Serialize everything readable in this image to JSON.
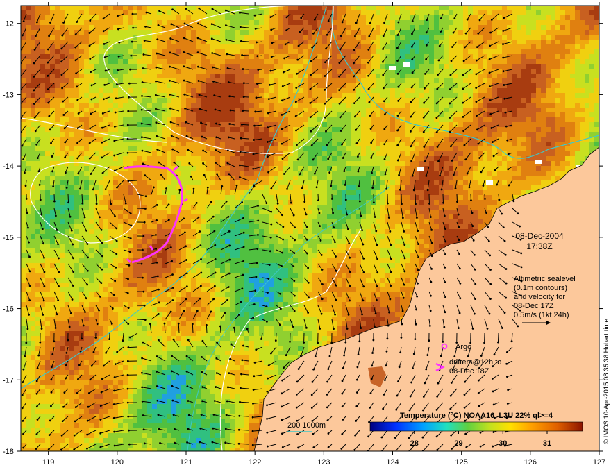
{
  "map": {
    "lon_range": [
      118.6,
      127.0
    ],
    "lat_range": [
      -18.0,
      -11.75
    ],
    "x_ticks": [
      {
        "value": 119,
        "label": "119"
      },
      {
        "value": 120,
        "label": "120"
      },
      {
        "value": 121,
        "label": "121"
      },
      {
        "value": 122,
        "label": "122"
      },
      {
        "value": 123,
        "label": "123"
      },
      {
        "value": 124,
        "label": "124"
      },
      {
        "value": 125,
        "label": "125"
      },
      {
        "value": 126,
        "label": "126"
      },
      {
        "value": 127,
        "label": "127"
      }
    ],
    "y_ticks": [
      {
        "value": -12,
        "label": "-12"
      },
      {
        "value": -13,
        "label": "-13"
      },
      {
        "value": -14,
        "label": "-14"
      },
      {
        "value": -15,
        "label": "-15"
      },
      {
        "value": -16,
        "label": "-16"
      },
      {
        "value": -17,
        "label": "-17"
      },
      {
        "value": -18,
        "label": "-18"
      }
    ]
  },
  "annotations": {
    "date": "08-Dec-2004",
    "time": "17:38Z",
    "legend_lines": [
      "Altimetric sealevel",
      "(0.1m contours)",
      "and velocity for",
      "08-Dec 17Z",
      "0.5m/s (1kt 24h)"
    ],
    "argo_label": "Argo",
    "drifters_line1": "drifters@12h to",
    "drifters_line2": "08-Dec 18Z",
    "depth_label": "200  1000m",
    "credit": "© IMOS 10-Apr-2015 08:35:38 Hobart time"
  },
  "colorbar": {
    "title": "Temperature (°C) NOAA16_L3U 22% ql>=4",
    "range": [
      27.0,
      31.8
    ],
    "ticks": [
      {
        "value": 28,
        "label": "28"
      },
      {
        "value": 29,
        "label": "29"
      },
      {
        "value": 30,
        "label": "30"
      },
      {
        "value": 31,
        "label": "31"
      }
    ]
  },
  "colors": {
    "land": "#fcc89b",
    "shelf_200m": "#3fc8c8",
    "sealevel_contour": "#ffffff",
    "drifter_track": "#ff33ff",
    "argo": "#ff33ff"
  }
}
